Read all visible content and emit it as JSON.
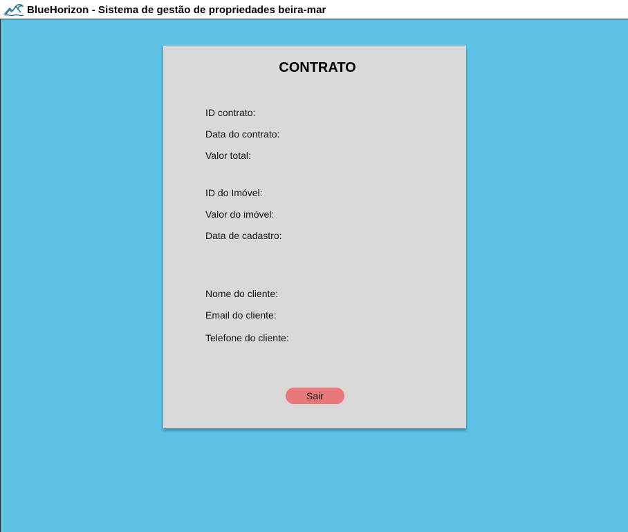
{
  "window": {
    "title": "BlueHorizon - Sistema de gestão de propriedades beira-mar",
    "logo_icon": "mountain-wave-icon",
    "background_color": "#5ec1e6"
  },
  "card": {
    "title": "CONTRATO",
    "contract": {
      "id_label": "ID contrato:",
      "date_label": "Data do contrato:",
      "total_label": "Valor total:"
    },
    "property": {
      "id_label": "ID do Imóvel:",
      "value_label": "Valor do imóvel:",
      "registration_date_label": "Data de cadastro:"
    },
    "client": {
      "name_label": "Nome do cliente:",
      "email_label": "Email do cliente:",
      "phone_label": "Telefone do cliente:"
    },
    "exit_button_label": "Sair",
    "exit_button_color": "#e8797a"
  }
}
